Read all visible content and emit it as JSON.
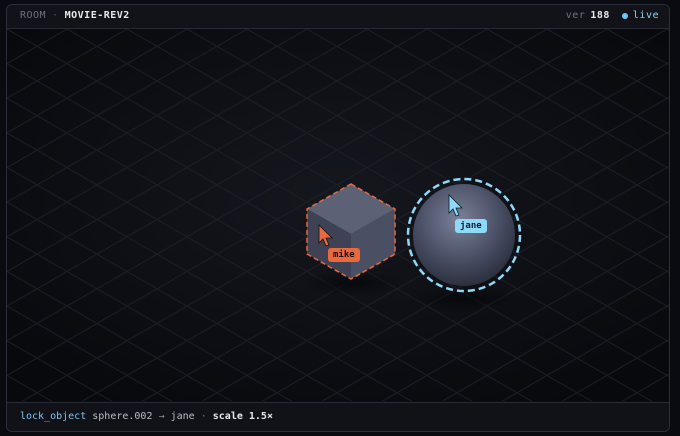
{
  "header": {
    "room_label": "ROOM",
    "separator": "·",
    "room_name": "MOVIE-REV2",
    "version_label": "ver",
    "version_value": "188",
    "live_label": "live"
  },
  "scene": {
    "objects": [
      {
        "type": "cube",
        "locked_by": "mike",
        "color": "#e8693d"
      },
      {
        "type": "sphere",
        "locked_by": "jane",
        "color": "#8fd8f8"
      }
    ],
    "cursors": [
      {
        "user": "mike",
        "label": "mike",
        "color": "#e8693d"
      },
      {
        "user": "jane",
        "label": "jane",
        "color": "#8fd8f8"
      }
    ]
  },
  "status": {
    "command": "lock_object",
    "object": "sphere.002",
    "arrow": "→",
    "user": "jane",
    "dot": "·",
    "scale_label": "scale 1.5×"
  }
}
